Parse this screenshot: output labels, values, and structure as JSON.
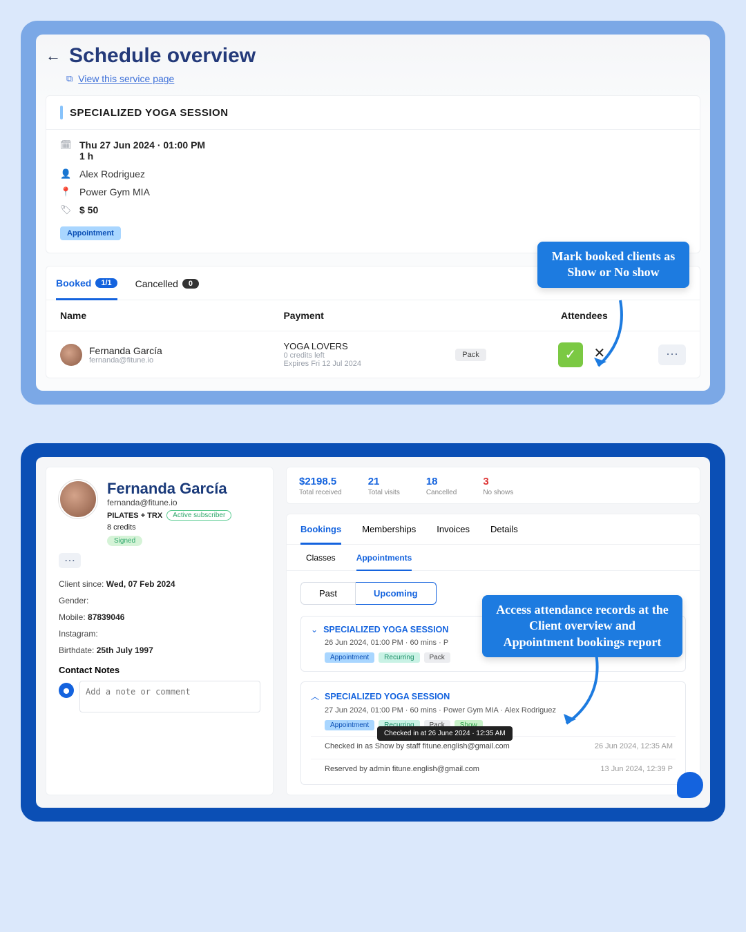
{
  "top": {
    "title": "Schedule overview",
    "view_link": "View this service page",
    "session_title": "SPECIALIZED YOGA SESSION",
    "datetime": "Thu 27 Jun 2024 · 01:00 PM",
    "duration": "1 h",
    "staff": "Alex Rodriguez",
    "location": "Power Gym MIA",
    "price": "$ 50",
    "appt_chip": "Appointment",
    "tab_booked": "Booked",
    "booked_count": "1/1",
    "tab_cancelled": "Cancelled",
    "cancelled_count": "0",
    "col_name": "Name",
    "col_payment": "Payment",
    "col_attendees": "Attendees",
    "row": {
      "name": "Fernanda García",
      "email": "fernanda@fitune.io",
      "pack_name": "YOGA LOVERS",
      "credits": "0 credits left",
      "expires": "Expires Fri 12 Jul 2024",
      "pack_chip": "Pack"
    },
    "callout": "Mark booked clients as Show or No show"
  },
  "bottom": {
    "profile": {
      "name": "Fernanda García",
      "email": "fernanda@fitune.io",
      "plan": "PILATES + TRX",
      "status": "Active subscriber",
      "credits": "8 credits",
      "signed": "Signed",
      "since_label": "Client since:",
      "since_val": "Wed, 07 Feb 2024",
      "gender_label": "Gender:",
      "mobile_label": "Mobile:",
      "mobile_val": "87839046",
      "ig_label": "Instagram:",
      "bd_label": "Birthdate:",
      "bd_val": "25th July 1997",
      "notes_title": "Contact Notes",
      "note_placeholder": "Add a note or comment"
    },
    "stats": {
      "total_received_v": "$2198.5",
      "total_received_l": "Total received",
      "visits_v": "21",
      "visits_l": "Total visits",
      "cancelled_v": "18",
      "cancelled_l": "Cancelled",
      "noshows_v": "3",
      "noshows_l": "No shows"
    },
    "tabs": {
      "bookings": "Bookings",
      "memberships": "Memberships",
      "invoices": "Invoices",
      "details": "Details",
      "classes": "Classes",
      "appointments": "Appointments",
      "past": "Past",
      "upcoming": "Upcoming"
    },
    "bk1": {
      "title": "SPECIALIZED YOGA SESSION",
      "sub": "26 Jun 2024, 01:00 PM · 60 mins · P",
      "appt": "Appointment",
      "rec": "Recurring",
      "pack": "Pack"
    },
    "bk2": {
      "title": "SPECIALIZED YOGA SESSION",
      "sub": "27 Jun 2024, 01:00 PM · 60 mins · Power Gym MIA · Alex Rodriguez",
      "appt": "Appointment",
      "rec": "Recurring",
      "pack": "Pack",
      "show": "Show",
      "tooltip": "Checked in at 26 June 2024 · 12:35 AM",
      "log1": "Checked in as Show by staff fitune.english@gmail.com",
      "log1_dt": "26 Jun 2024, 12:35 AM",
      "log2": "Reserved by admin fitune.english@gmail.com",
      "log2_dt": "13 Jun 2024, 12:39 P"
    },
    "callout": "Access attendance records at the Client overview and Appointment bookings report"
  }
}
